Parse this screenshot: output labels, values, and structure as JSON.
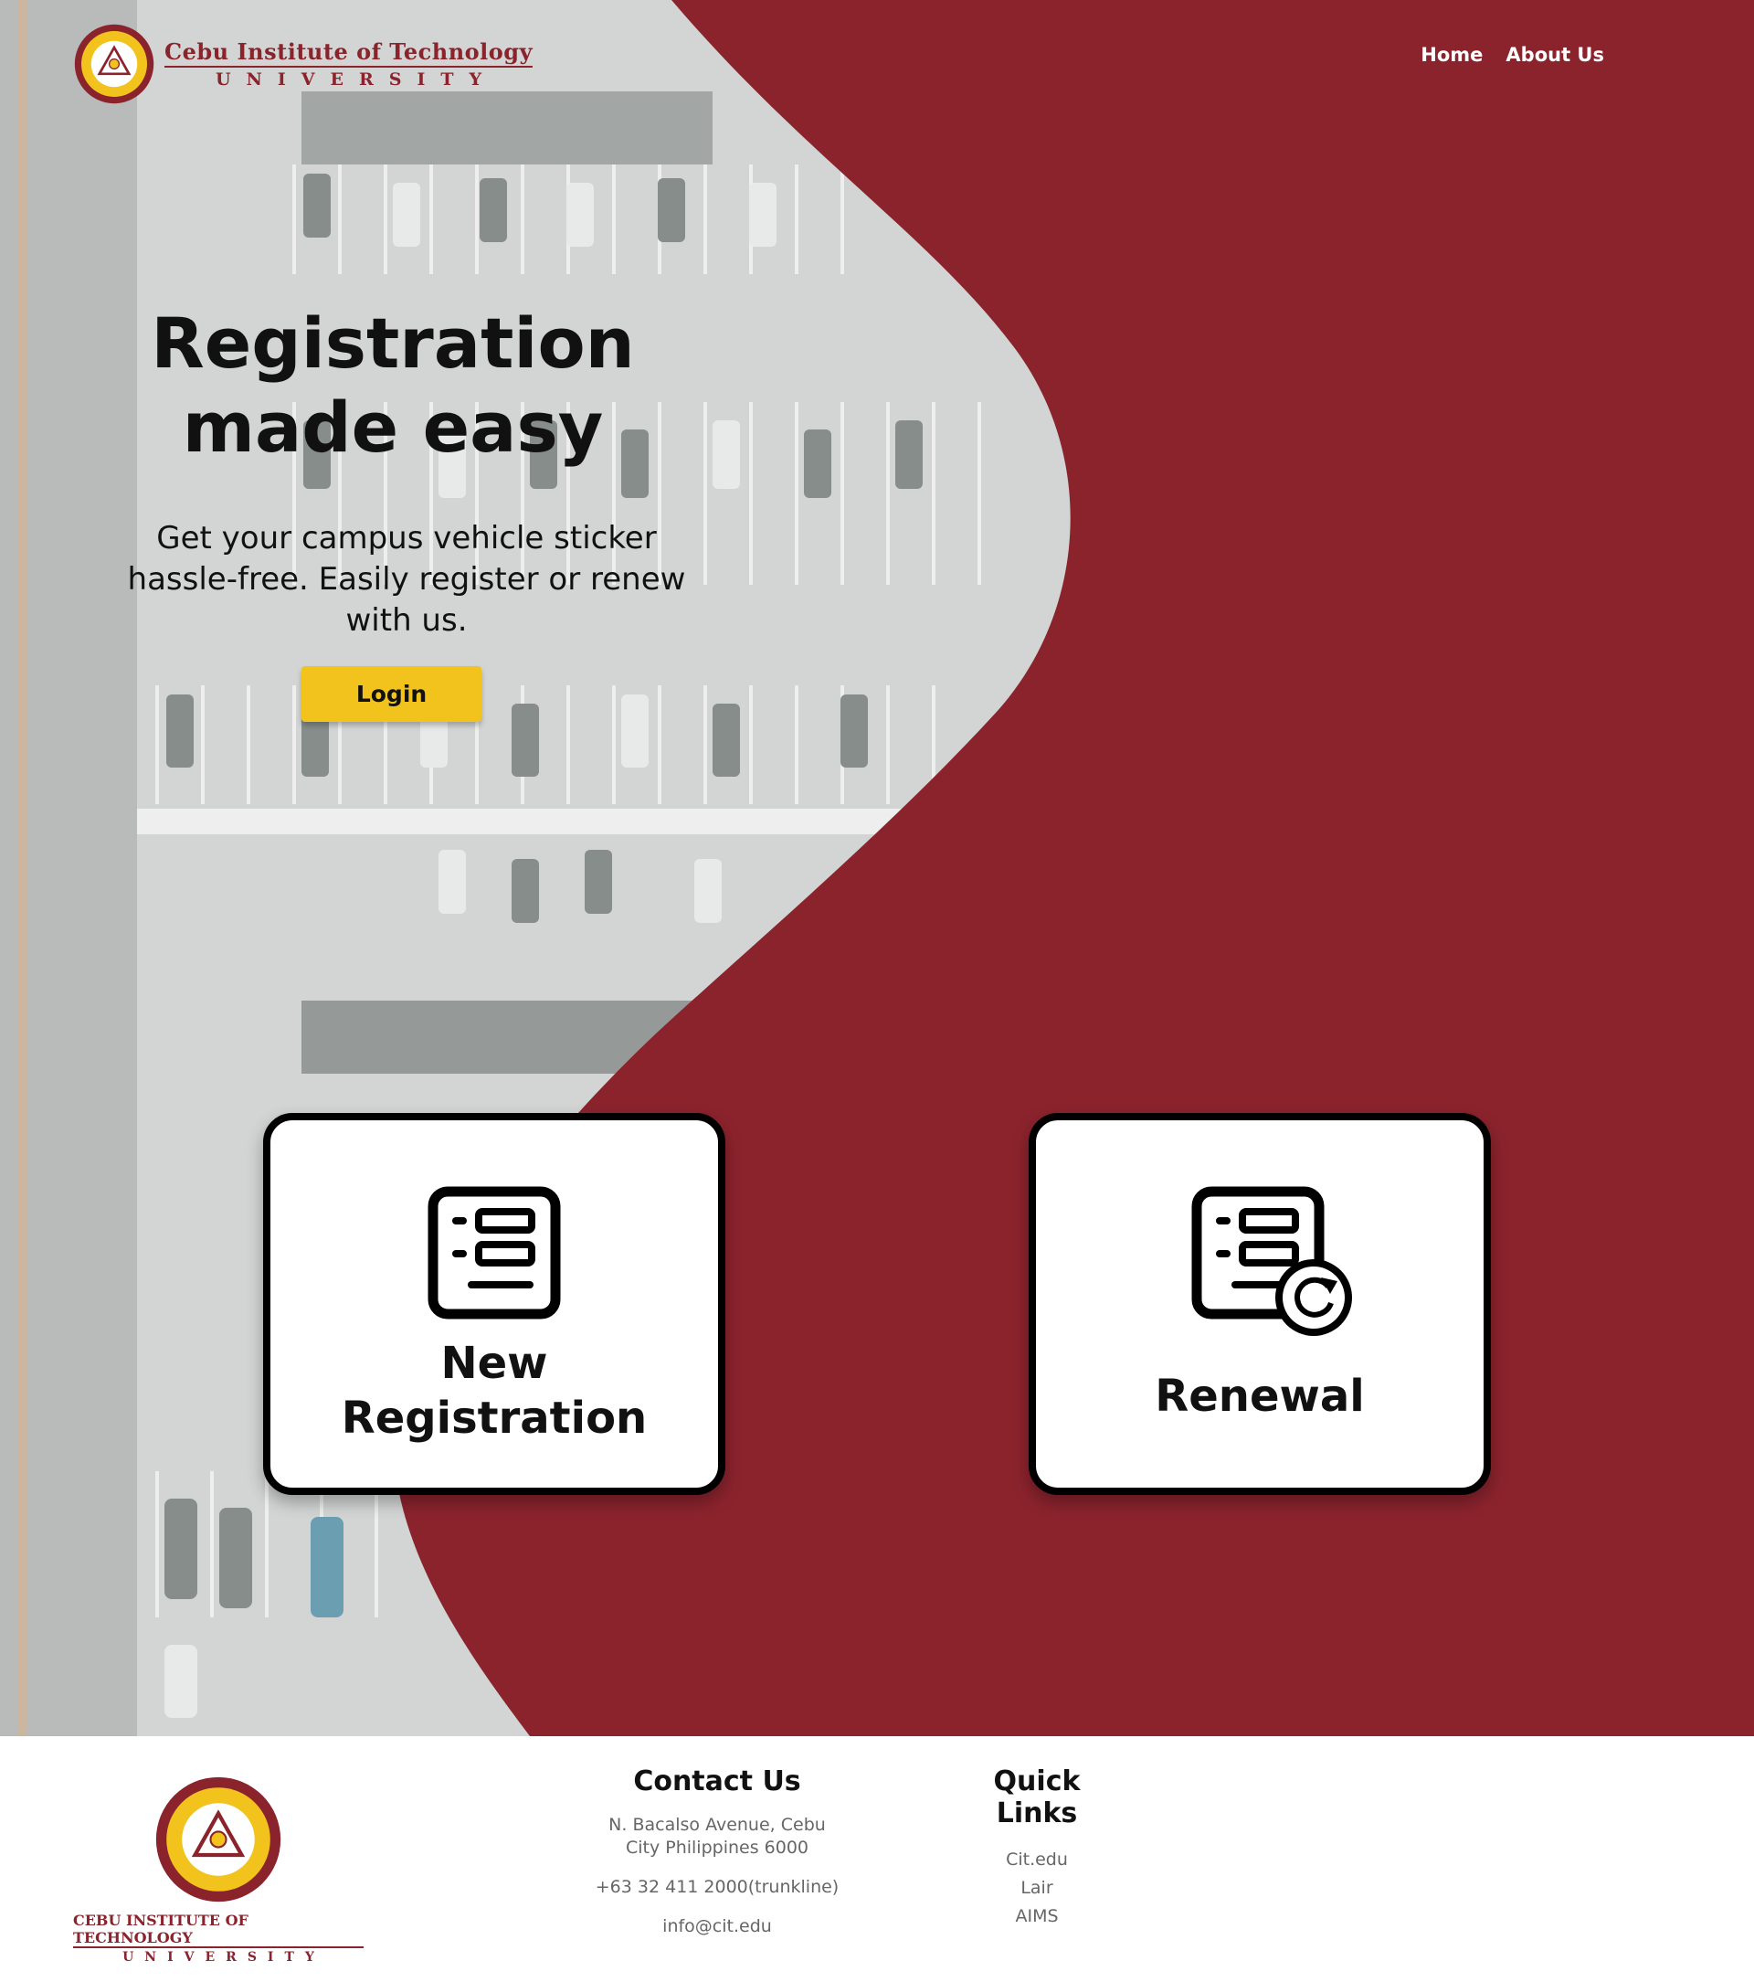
{
  "brand": {
    "name_line1": "Cebu Institute of Technology",
    "name_line2": "UNIVERSITY",
    "logo_icon": "cit-seal-logo"
  },
  "nav": {
    "items": [
      {
        "label": "Home"
      },
      {
        "label": "About Us"
      }
    ]
  },
  "hero": {
    "headline_line1": "Registration",
    "headline_line2": "made easy",
    "subtext": "Get your campus vehicle sticker hassle-free. Easily register or renew with us.",
    "login_label": "Login",
    "background": "aerial-parking-lot-photo"
  },
  "cards": {
    "new_registration": {
      "label_line1": "New",
      "label_line2": "Registration",
      "icon": "form-document-icon"
    },
    "renewal": {
      "label": "Renewal",
      "icon": "form-document-refresh-icon"
    }
  },
  "footer": {
    "logo_line1": "CEBU INSTITUTE OF TECHNOLOGY",
    "logo_line2": "UNIVERSITY",
    "contact": {
      "heading": "Contact Us",
      "address_line1": "N. Bacalso Avenue, Cebu",
      "address_line2": "City Philippines 6000",
      "phone": "+63 32 411 2000(trunkline)",
      "email": "info@cit.edu"
    },
    "quick_links": {
      "heading": "Quick Links",
      "items": [
        {
          "label": "Cit.edu"
        },
        {
          "label": "Lair"
        },
        {
          "label": "AIMS"
        }
      ]
    }
  },
  "colors": {
    "maroon": "#8b232d",
    "gold": "#f2c31d",
    "footer_text": "#666666"
  }
}
